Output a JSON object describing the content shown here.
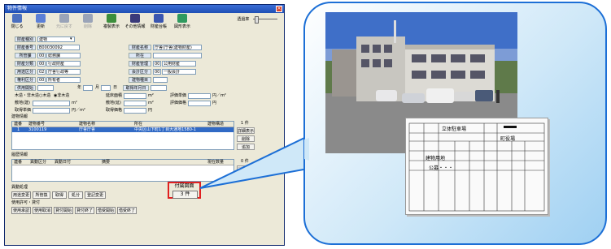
{
  "window": {
    "title": "物件情報",
    "close": "×"
  },
  "toolbar": {
    "buttons": [
      {
        "label": "閉じる",
        "icon": "close-doc-icon",
        "color": "#4a6fbf",
        "dim": false
      },
      {
        "label": "更新",
        "icon": "refresh-icon",
        "color": "#5b7fd6",
        "dim": false
      },
      {
        "label": "元に戻す",
        "icon": "undo-icon",
        "color": "#9aa4b8",
        "dim": true
      },
      {
        "label": "削除",
        "icon": "delete-icon",
        "color": "#9aa4b8",
        "dim": true
      },
      {
        "label": "複製表示",
        "icon": "copy-view-icon",
        "color": "#3c8e3c",
        "dim": false
      },
      {
        "label": "その他情報",
        "icon": "info-icon",
        "color": "#3a3a7a",
        "dim": false
      },
      {
        "label": "財産台帳",
        "icon": "ledger-icon",
        "color": "#3a56b0",
        "dim": false
      },
      {
        "label": "図形表示",
        "icon": "map-icon",
        "color": "#2f9a5f",
        "dim": false
      }
    ],
    "zoom_label": "透過率"
  },
  "form": {
    "kind_label": "財産種別",
    "kind_value": "建物",
    "no_label": "財産番号",
    "no_value": "B00030092",
    "name_label": "財産名称",
    "name_value": "庁舎(庁舎(建物財産)",
    "dept_label": "所管課",
    "dept_code": "001",
    "dept_name": "総務課",
    "addr_label": "所在",
    "cat_label": "財産分類",
    "cat_code": "001",
    "cat_name": "行政財産",
    "mgr_label": "財産管理",
    "mgr_code": "001",
    "mgr_name": "公用財産",
    "use_label": "用途区分",
    "use_code": "021",
    "use_name": "庁舎行政等",
    "acct_label": "会計区分",
    "acct_code": "001",
    "acct_name": "一般会計",
    "own_label": "権利区分",
    "own_code": "001",
    "own_name": "所有者",
    "date_label": "建物種目",
    "use_start_label": "供用開始",
    "year": "年",
    "month": "月",
    "day": "日",
    "acq_date_label": "取得年月日",
    "struct_label": "木造・非木造",
    "struct_opt1": "木造",
    "struct_opt2": "非木造",
    "unit_m2": "m²",
    "unit_yen": "円",
    "unit_yen_m2": "円／m²",
    "floor_label": "延床面積",
    "eval_unit_label": "評価単価",
    "area1_label": "敷地(建)",
    "area2_label": "敷地(延)",
    "eval_label": "評価価格",
    "price_label": "取得単価",
    "cost_label": "取得価格"
  },
  "buildings": {
    "section": "建物情報",
    "headers": [
      "連番",
      "建物番号",
      "建物名称",
      "所在",
      "建物構造"
    ],
    "rows": [
      [
        "1",
        "3100119",
        "庁舎庁舎",
        "中央区山下町1丁目大通地1580-1",
        ""
      ]
    ],
    "count": "1 件",
    "side_buttons": [
      "詳細表示",
      "削除",
      "追加"
    ]
  },
  "history": {
    "section": "履歴情報",
    "headers": [
      "連番",
      "異動区分",
      "異動日付",
      "摘要",
      "現在数量"
    ],
    "count": "0 件",
    "side_button": "詳細表示"
  },
  "actions": {
    "section1": "異動処理",
    "buttons1": [
      "用途変更",
      "所管換",
      "取得",
      "処分",
      "登記変更"
    ],
    "section2": "使用許可・貸付",
    "buttons2": [
      "使用承認",
      "使用取消",
      "貸付開始",
      "貸付終了",
      "借受開始",
      "借受終了"
    ]
  },
  "attach": {
    "label": "付属図面",
    "count": "3 件"
  },
  "document": {
    "title": "立体駐車場",
    "owner": "町役場",
    "row1": "建物用地",
    "row2": "公募・・・"
  }
}
